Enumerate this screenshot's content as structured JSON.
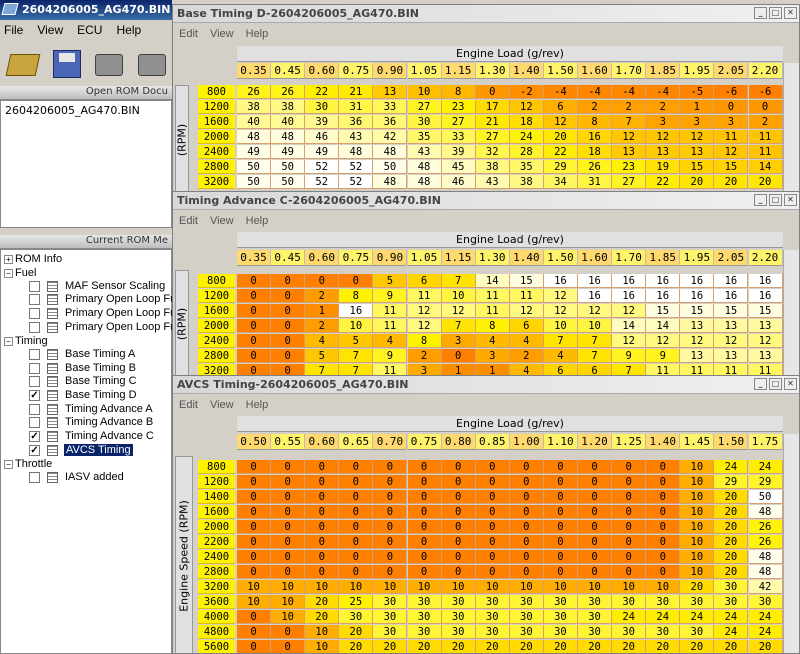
{
  "app": {
    "title": "2604206005_AG470.BIN - E",
    "menu": [
      "File",
      "View",
      "ECU",
      "Help"
    ],
    "toolbar_icons": [
      "open-folder-icon",
      "save-disk-icon",
      "ecu-chip-icon",
      "ecu-chip-icon"
    ]
  },
  "rom_panel": {
    "header": "Open ROM Docu",
    "items": [
      "2604206005_AG470.BIN"
    ]
  },
  "tree_panel": {
    "header": "Current ROM Me"
  },
  "tree": {
    "rom_info": "ROM Info",
    "fuel": "Fuel",
    "fuel_items": [
      {
        "label": "MAF Sensor Scaling",
        "checked": false
      },
      {
        "label": "Primary Open Loop Fu",
        "checked": false
      },
      {
        "label": "Primary Open Loop Fu",
        "checked": false
      },
      {
        "label": "Primary Open Loop Fu",
        "checked": false
      }
    ],
    "timing": "Timing",
    "timing_items": [
      {
        "label": "Base Timing A",
        "checked": false
      },
      {
        "label": "Base Timing B",
        "checked": false
      },
      {
        "label": "Base Timing C",
        "checked": false
      },
      {
        "label": "Base Timing D",
        "checked": true
      },
      {
        "label": "Timing Advance A",
        "checked": false
      },
      {
        "label": "Timing Advance B",
        "checked": false
      },
      {
        "label": "Timing Advance C",
        "checked": true
      },
      {
        "label": "AVCS Timing",
        "checked": true,
        "selected": true
      }
    ],
    "throttle": "Throttle",
    "throttle_items": [
      {
        "label": "IASV added",
        "checked": false
      }
    ]
  },
  "windows": [
    {
      "title": "Base Timing D-2604206005_AG470.BIN",
      "menu": [
        "Edit",
        "View",
        "Help"
      ],
      "x_label": "Engine Load (g/rev)",
      "y_label": "(RPM)",
      "x_axis": [
        "0.35",
        "0.45",
        "0.60",
        "0.75",
        "0.90",
        "1.05",
        "1.15",
        "1.30",
        "1.40",
        "1.50",
        "1.60",
        "1.70",
        "1.85",
        "1.95",
        "2.05",
        "2.20"
      ],
      "rows": [
        {
          "rpm": "800",
          "vals": [
            "26",
            "26",
            "22",
            "21",
            "13",
            "10",
            "8",
            "0",
            "-2",
            "-4",
            "-4",
            "-4",
            "-4",
            "-5",
            "-6",
            "-6"
          ]
        },
        {
          "rpm": "1200",
          "vals": [
            "38",
            "38",
            "30",
            "31",
            "33",
            "27",
            "23",
            "17",
            "12",
            "6",
            "2",
            "2",
            "2",
            "1",
            "0",
            "0"
          ]
        },
        {
          "rpm": "1600",
          "vals": [
            "40",
            "40",
            "39",
            "36",
            "36",
            "30",
            "27",
            "21",
            "18",
            "12",
            "8",
            "7",
            "3",
            "3",
            "3",
            "2"
          ]
        },
        {
          "rpm": "2000",
          "vals": [
            "48",
            "48",
            "46",
            "43",
            "42",
            "35",
            "33",
            "27",
            "24",
            "20",
            "16",
            "12",
            "12",
            "12",
            "11",
            "11"
          ]
        },
        {
          "rpm": "2400",
          "vals": [
            "49",
            "49",
            "49",
            "48",
            "48",
            "43",
            "39",
            "32",
            "28",
            "22",
            "18",
            "13",
            "13",
            "13",
            "12",
            "11"
          ]
        },
        {
          "rpm": "2800",
          "vals": [
            "50",
            "50",
            "52",
            "52",
            "50",
            "48",
            "45",
            "38",
            "35",
            "29",
            "26",
            "23",
            "19",
            "15",
            "15",
            "14"
          ]
        },
        {
          "rpm": "3200",
          "vals": [
            "50",
            "50",
            "52",
            "52",
            "48",
            "48",
            "46",
            "43",
            "38",
            "34",
            "31",
            "27",
            "22",
            "20",
            "20",
            "20"
          ]
        }
      ]
    },
    {
      "title": "Timing Advance C-2604206005_AG470.BIN",
      "menu": [
        "Edit",
        "View",
        "Help"
      ],
      "x_label": "Engine Load (g/rev)",
      "y_label": "(RPM)",
      "x_axis": [
        "0.35",
        "0.45",
        "0.60",
        "0.75",
        "0.90",
        "1.05",
        "1.15",
        "1.30",
        "1.40",
        "1.50",
        "1.60",
        "1.70",
        "1.85",
        "1.95",
        "2.05",
        "2.20"
      ],
      "rows": [
        {
          "rpm": "800",
          "vals": [
            "0",
            "0",
            "0",
            "0",
            "5",
            "6",
            "7",
            "14",
            "15",
            "16",
            "16",
            "16",
            "16",
            "16",
            "16",
            "16"
          ]
        },
        {
          "rpm": "1200",
          "vals": [
            "0",
            "0",
            "2",
            "8",
            "9",
            "11",
            "10",
            "11",
            "11",
            "12",
            "16",
            "16",
            "16",
            "16",
            "16",
            "16"
          ]
        },
        {
          "rpm": "1600",
          "vals": [
            "0",
            "0",
            "1",
            "16",
            "11",
            "12",
            "12",
            "11",
            "12",
            "12",
            "12",
            "12",
            "15",
            "15",
            "15",
            "15"
          ]
        },
        {
          "rpm": "2000",
          "vals": [
            "0",
            "0",
            "2",
            "10",
            "11",
            "12",
            "7",
            "8",
            "6",
            "10",
            "10",
            "14",
            "14",
            "13",
            "13",
            "13"
          ]
        },
        {
          "rpm": "2400",
          "vals": [
            "0",
            "0",
            "4",
            "5",
            "4",
            "8",
            "3",
            "4",
            "4",
            "7",
            "7",
            "12",
            "12",
            "12",
            "12",
            "12"
          ]
        },
        {
          "rpm": "2800",
          "vals": [
            "0",
            "0",
            "5",
            "7",
            "9",
            "2",
            "0",
            "3",
            "2",
            "4",
            "7",
            "9",
            "9",
            "13",
            "13",
            "13"
          ]
        },
        {
          "rpm": "3200",
          "vals": [
            "0",
            "0",
            "7",
            "7",
            "11",
            "3",
            "1",
            "1",
            "4",
            "6",
            "6",
            "7",
            "11",
            "11",
            "11",
            "11"
          ]
        }
      ]
    },
    {
      "title": "AVCS Timing-2604206005_AG470.BIN",
      "menu": [
        "Edit",
        "View",
        "Help"
      ],
      "x_label": "Engine Load (g/rev)",
      "y_label": "Engine Speed (RPM)",
      "x_axis": [
        "0.50",
        "0.55",
        "0.60",
        "0.65",
        "0.70",
        "0.75",
        "0.80",
        "0.85",
        "1.00",
        "1.10",
        "1.20",
        "1.25",
        "1.40",
        "1.45",
        "1.50",
        "1.75"
      ],
      "rows": [
        {
          "rpm": "800",
          "vals": [
            "0",
            "0",
            "0",
            "0",
            "0",
            "0",
            "0",
            "0",
            "0",
            "0",
            "0",
            "0",
            "0",
            "10",
            "24",
            "24"
          ]
        },
        {
          "rpm": "1200",
          "vals": [
            "0",
            "0",
            "0",
            "0",
            "0",
            "0",
            "0",
            "0",
            "0",
            "0",
            "0",
            "0",
            "0",
            "10",
            "29",
            "29"
          ]
        },
        {
          "rpm": "1400",
          "vals": [
            "0",
            "0",
            "0",
            "0",
            "0",
            "0",
            "0",
            "0",
            "0",
            "0",
            "0",
            "0",
            "0",
            "10",
            "20",
            "50"
          ]
        },
        {
          "rpm": "1600",
          "vals": [
            "0",
            "0",
            "0",
            "0",
            "0",
            "0",
            "0",
            "0",
            "0",
            "0",
            "0",
            "0",
            "0",
            "10",
            "20",
            "48"
          ]
        },
        {
          "rpm": "2000",
          "vals": [
            "0",
            "0",
            "0",
            "0",
            "0",
            "0",
            "0",
            "0",
            "0",
            "0",
            "0",
            "0",
            "0",
            "10",
            "20",
            "26"
          ]
        },
        {
          "rpm": "2200",
          "vals": [
            "0",
            "0",
            "0",
            "0",
            "0",
            "0",
            "0",
            "0",
            "0",
            "0",
            "0",
            "0",
            "0",
            "10",
            "20",
            "26"
          ]
        },
        {
          "rpm": "2400",
          "vals": [
            "0",
            "0",
            "0",
            "0",
            "0",
            "0",
            "0",
            "0",
            "0",
            "0",
            "0",
            "0",
            "0",
            "10",
            "20",
            "48"
          ]
        },
        {
          "rpm": "2800",
          "vals": [
            "0",
            "0",
            "0",
            "0",
            "0",
            "0",
            "0",
            "0",
            "0",
            "0",
            "0",
            "0",
            "0",
            "10",
            "20",
            "48"
          ]
        },
        {
          "rpm": "3200",
          "vals": [
            "10",
            "10",
            "10",
            "10",
            "10",
            "10",
            "10",
            "10",
            "10",
            "10",
            "10",
            "10",
            "10",
            "20",
            "30",
            "42"
          ]
        },
        {
          "rpm": "3600",
          "vals": [
            "10",
            "10",
            "20",
            "25",
            "30",
            "30",
            "30",
            "30",
            "30",
            "30",
            "30",
            "30",
            "30",
            "30",
            "30",
            "30"
          ]
        },
        {
          "rpm": "4000",
          "vals": [
            "0",
            "10",
            "20",
            "30",
            "30",
            "30",
            "30",
            "30",
            "30",
            "30",
            "30",
            "24",
            "24",
            "24",
            "24",
            "24"
          ]
        },
        {
          "rpm": "4800",
          "vals": [
            "0",
            "0",
            "10",
            "20",
            "30",
            "30",
            "30",
            "30",
            "30",
            "30",
            "30",
            "30",
            "30",
            "30",
            "24",
            "24"
          ]
        },
        {
          "rpm": "5600",
          "vals": [
            "0",
            "0",
            "10",
            "20",
            "20",
            "20",
            "20",
            "20",
            "20",
            "20",
            "20",
            "20",
            "20",
            "20",
            "20",
            "20"
          ]
        }
      ]
    }
  ],
  "colors": {
    "selection": "#0a246a",
    "axis_header": "#fff200",
    "heat_low": "#ff7f00",
    "heat_high": "#ffffff"
  }
}
